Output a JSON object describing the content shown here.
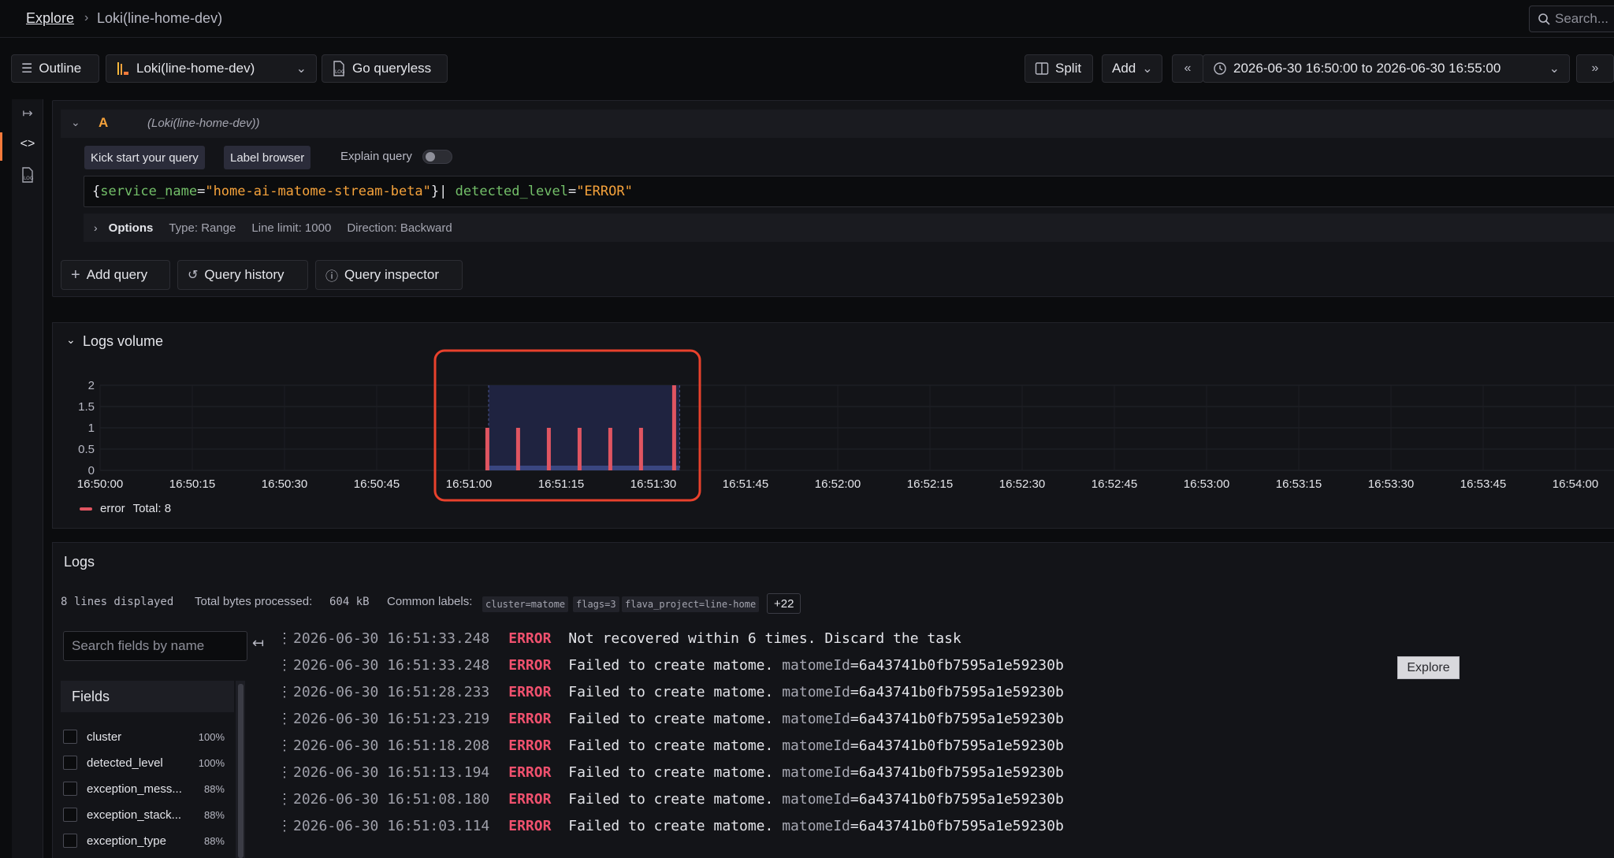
{
  "breadcrumb": {
    "root": "Explore",
    "current": "Loki(line-home-dev)"
  },
  "search": {
    "placeholder": "Search..."
  },
  "toolbar": {
    "outline": "Outline",
    "datasource": "Loki(line-home-dev)",
    "queryless": "Go queryless",
    "split": "Split",
    "add": "Add",
    "time_range": "2026-06-30 16:50:00 to 2026-06-30 16:55:00"
  },
  "query": {
    "letter": "A",
    "datasource": "(Loki(line-home-dev))",
    "kick_start": "Kick start your query",
    "label_browser": "Label browser",
    "explain": "Explain query",
    "expr": {
      "open": "{",
      "label1": "service_name",
      "eq1": "=",
      "val1": "\"home-ai-matome-stream-beta\"",
      "close": "}",
      "pipe": "| ",
      "label2": "detected_level",
      "eq2": "=",
      "val2": "\"ERROR\""
    },
    "options_label": "Options",
    "type": "Type: Range",
    "line_limit": "Line limit: 1000",
    "direction": "Direction: Backward"
  },
  "query_actions": {
    "add_query": "Add query",
    "history": "Query history",
    "inspector": "Query inspector"
  },
  "volume": {
    "title": "Logs volume",
    "legend_name": "error",
    "legend_total": "Total: 8"
  },
  "chart_data": {
    "type": "bar",
    "ylim": [
      0,
      2
    ],
    "y_ticks": [
      "0",
      "0.5",
      "1",
      "1.5",
      "2"
    ],
    "x_ticks": [
      "16:50:00",
      "16:50:15",
      "16:50:30",
      "16:50:45",
      "16:51:00",
      "16:51:15",
      "16:51:30",
      "16:51:45",
      "16:52:00",
      "16:52:15",
      "16:52:30",
      "16:52:45",
      "16:53:00",
      "16:53:15",
      "16:53:30",
      "16:53:45",
      "16:54:00"
    ],
    "series": [
      {
        "name": "error",
        "color": "#e05561",
        "x": [
          "16:51:03",
          "16:51:08",
          "16:51:13",
          "16:51:18",
          "16:51:23",
          "16:51:28",
          "16:51:33"
        ],
        "values": [
          1,
          1,
          1,
          1,
          1,
          1,
          2
        ]
      }
    ],
    "highlight_range": [
      "16:51:00",
      "16:51:33"
    ]
  },
  "logs": {
    "title": "Logs",
    "lines_displayed": "8 lines displayed",
    "bytes_label": "Total bytes processed:",
    "bytes_value": "604 kB",
    "common_labels": "Common labels:",
    "labels": [
      "cluster=matome",
      "flags=3",
      "flava_project=line-home"
    ],
    "more_labels": "+22",
    "fields_search_placeholder": "Search fields by name",
    "fields_header": "Fields",
    "fields": [
      {
        "name": "cluster",
        "pct": "100%"
      },
      {
        "name": "detected_level",
        "pct": "100%"
      },
      {
        "name": "exception_mess...",
        "pct": "88%"
      },
      {
        "name": "exception_stack...",
        "pct": "88%"
      },
      {
        "name": "exception_type",
        "pct": "88%"
      }
    ],
    "rows": [
      {
        "ts": "2026-06-30 16:51:33.248",
        "level": "ERROR",
        "msg": "Not recovered within 6 times. Discard the task",
        "key": "",
        "val": ""
      },
      {
        "ts": "2026-06-30 16:51:33.248",
        "level": "ERROR",
        "msg": "Failed to create matome. ",
        "key": "matomeId",
        "val": "=6a43741b0fb7595a1e59230b"
      },
      {
        "ts": "2026-06-30 16:51:28.233",
        "level": "ERROR",
        "msg": "Failed to create matome. ",
        "key": "matomeId",
        "val": "=6a43741b0fb7595a1e59230b"
      },
      {
        "ts": "2026-06-30 16:51:23.219",
        "level": "ERROR",
        "msg": "Failed to create matome. ",
        "key": "matomeId",
        "val": "=6a43741b0fb7595a1e59230b"
      },
      {
        "ts": "2026-06-30 16:51:18.208",
        "level": "ERROR",
        "msg": "Failed to create matome. ",
        "key": "matomeId",
        "val": "=6a43741b0fb7595a1e59230b"
      },
      {
        "ts": "2026-06-30 16:51:13.194",
        "level": "ERROR",
        "msg": "Failed to create matome. ",
        "key": "matomeId",
        "val": "=6a43741b0fb7595a1e59230b"
      },
      {
        "ts": "2026-06-30 16:51:08.180",
        "level": "ERROR",
        "msg": "Failed to create matome. ",
        "key": "matomeId",
        "val": "=6a43741b0fb7595a1e59230b"
      },
      {
        "ts": "2026-06-30 16:51:03.114",
        "level": "ERROR",
        "msg": "Failed to create matome. ",
        "key": "matomeId",
        "val": "=6a43741b0fb7595a1e59230b"
      }
    ],
    "explore_button": "Explore"
  },
  "colors": {
    "accent": "#f57a3b",
    "error": "#f0516e",
    "bar": "#e05561",
    "highlight": "#e8412c"
  }
}
